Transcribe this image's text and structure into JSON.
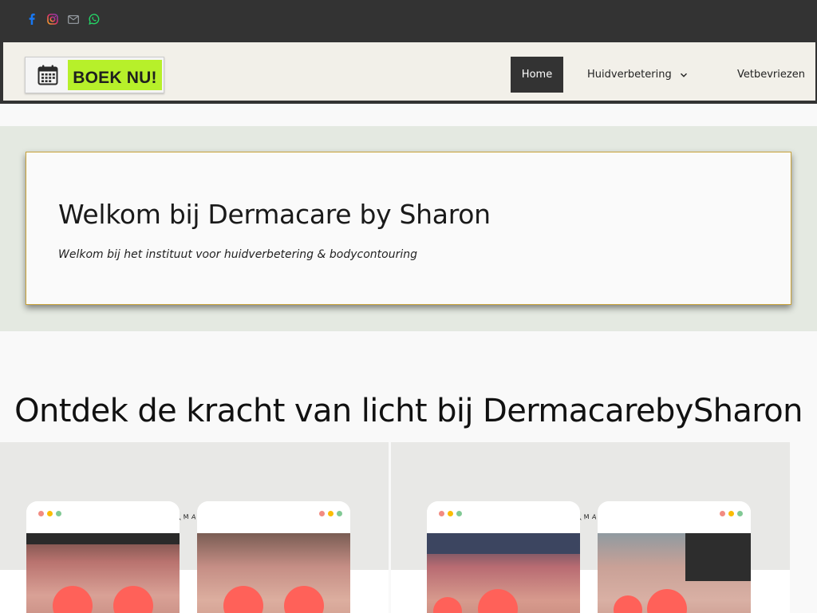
{
  "social": {
    "icons": [
      "facebook-icon",
      "instagram-icon",
      "mail-icon",
      "whatsapp-icon"
    ],
    "colors": {
      "facebook": "#1877f2",
      "instagram": "#c13584",
      "mail": "#9aa0a6",
      "whatsapp": "#25d366"
    }
  },
  "header": {
    "logo_label": "BOEK NU!",
    "nav": [
      {
        "label": "Home",
        "active": true
      },
      {
        "label": "Huidverbetering",
        "has_dropdown": true
      },
      {
        "label": "Vetbevriezen"
      }
    ]
  },
  "hero": {
    "title": "Welkom bij Dermacare by Sharon",
    "subtitle": "Welkom bij het instituut voor huidverbetering & bodycontouring"
  },
  "section": {
    "title": "Ontdek de kracht van licht bij DermacarebySharon"
  },
  "gallery": {
    "label": "TRANSFORMATION"
  },
  "colors": {
    "topbar": "#333333",
    "header_bg": "#f2f0e9",
    "accent_green": "#b7f02a",
    "hero_bg": "#e4e9e1",
    "card_border": "#c9a33a",
    "blob": "#ff6159"
  }
}
